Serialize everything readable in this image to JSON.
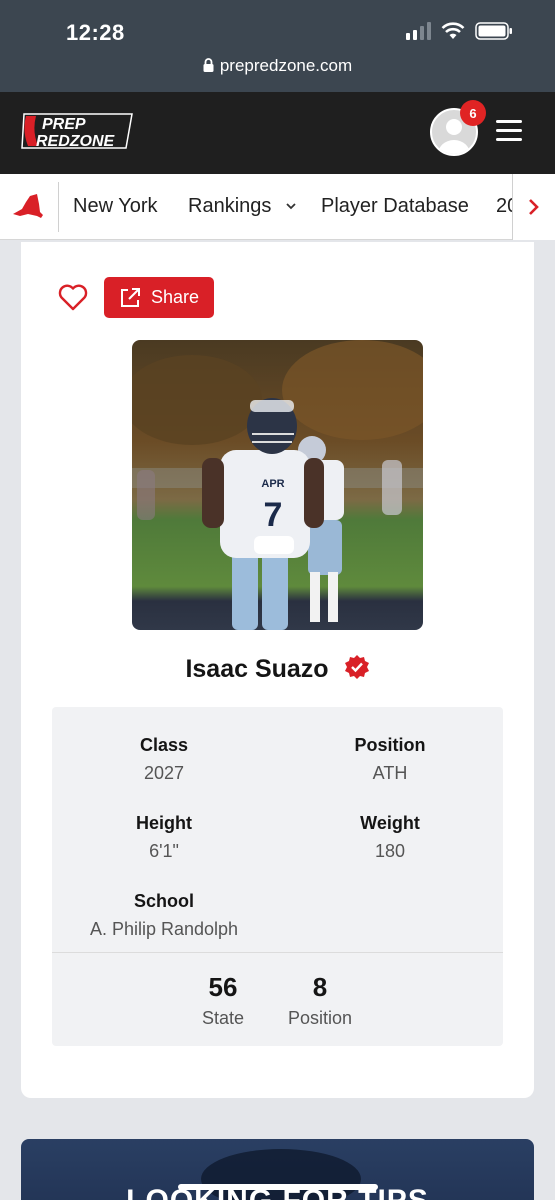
{
  "status_bar": {
    "time": "12:28",
    "url": "prepredzone.com"
  },
  "header": {
    "logo_top": "PREP",
    "logo_bottom": "REDZONE",
    "notification_count": "6"
  },
  "nav": {
    "items": [
      {
        "label": "New York"
      },
      {
        "label": "Rankings",
        "has_dropdown": true
      },
      {
        "label": "Player Database"
      },
      {
        "label": "20"
      }
    ]
  },
  "profile": {
    "share_label": "Share",
    "name": "Isaac Suazo",
    "fields": {
      "class_label": "Class",
      "class_value": "2027",
      "position_label": "Position",
      "position_value": "ATH",
      "height_label": "Height",
      "height_value": "6'1\"",
      "weight_label": "Weight",
      "weight_value": "180",
      "school_label": "School",
      "school_value": "A. Philip Randolph"
    },
    "rankings": [
      {
        "number": "56",
        "label": "State"
      },
      {
        "number": "8",
        "label": "Position"
      }
    ],
    "jersey": {
      "team": "APR",
      "number": "7"
    }
  },
  "promo": {
    "title": "LOOKING FOR TIPS"
  },
  "colors": {
    "brand_red": "#d92027",
    "header_bg": "#1f1f1f",
    "promo_bg": "#223455"
  }
}
